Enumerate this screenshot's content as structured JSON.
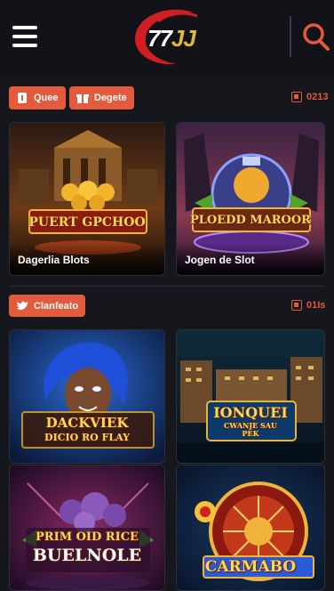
{
  "header": {
    "logo_text": "77",
    "logo_suffix": "JJ"
  },
  "section1": {
    "chip1_label": "Quee",
    "chip2_label": "Degete",
    "counter": "0213",
    "games": [
      {
        "banner": "PUERT GPCHOO",
        "title": "Dagerlia Blots"
      },
      {
        "banner": "PLOEDD MAROOR",
        "title": "Jogen de Slot"
      }
    ]
  },
  "section2": {
    "chip_label": "Clanfeato",
    "counter": "01Is",
    "games": [
      {
        "banner_line1": "DACKVIEK",
        "banner_line2": "DICIO RO FLAY"
      },
      {
        "banner_line1": "IONQUEI",
        "banner_line2": "CWANJE SAU",
        "banner_line3": "PEK"
      },
      {
        "banner_line1": "PRIM OID RICE",
        "banner_line2": "BUELNOLE"
      },
      {
        "banner_line1": "CARMABO"
      }
    ]
  },
  "colors": {
    "accent": "#e35a3c",
    "background": "#15171c",
    "gold": "#ffd65a"
  }
}
